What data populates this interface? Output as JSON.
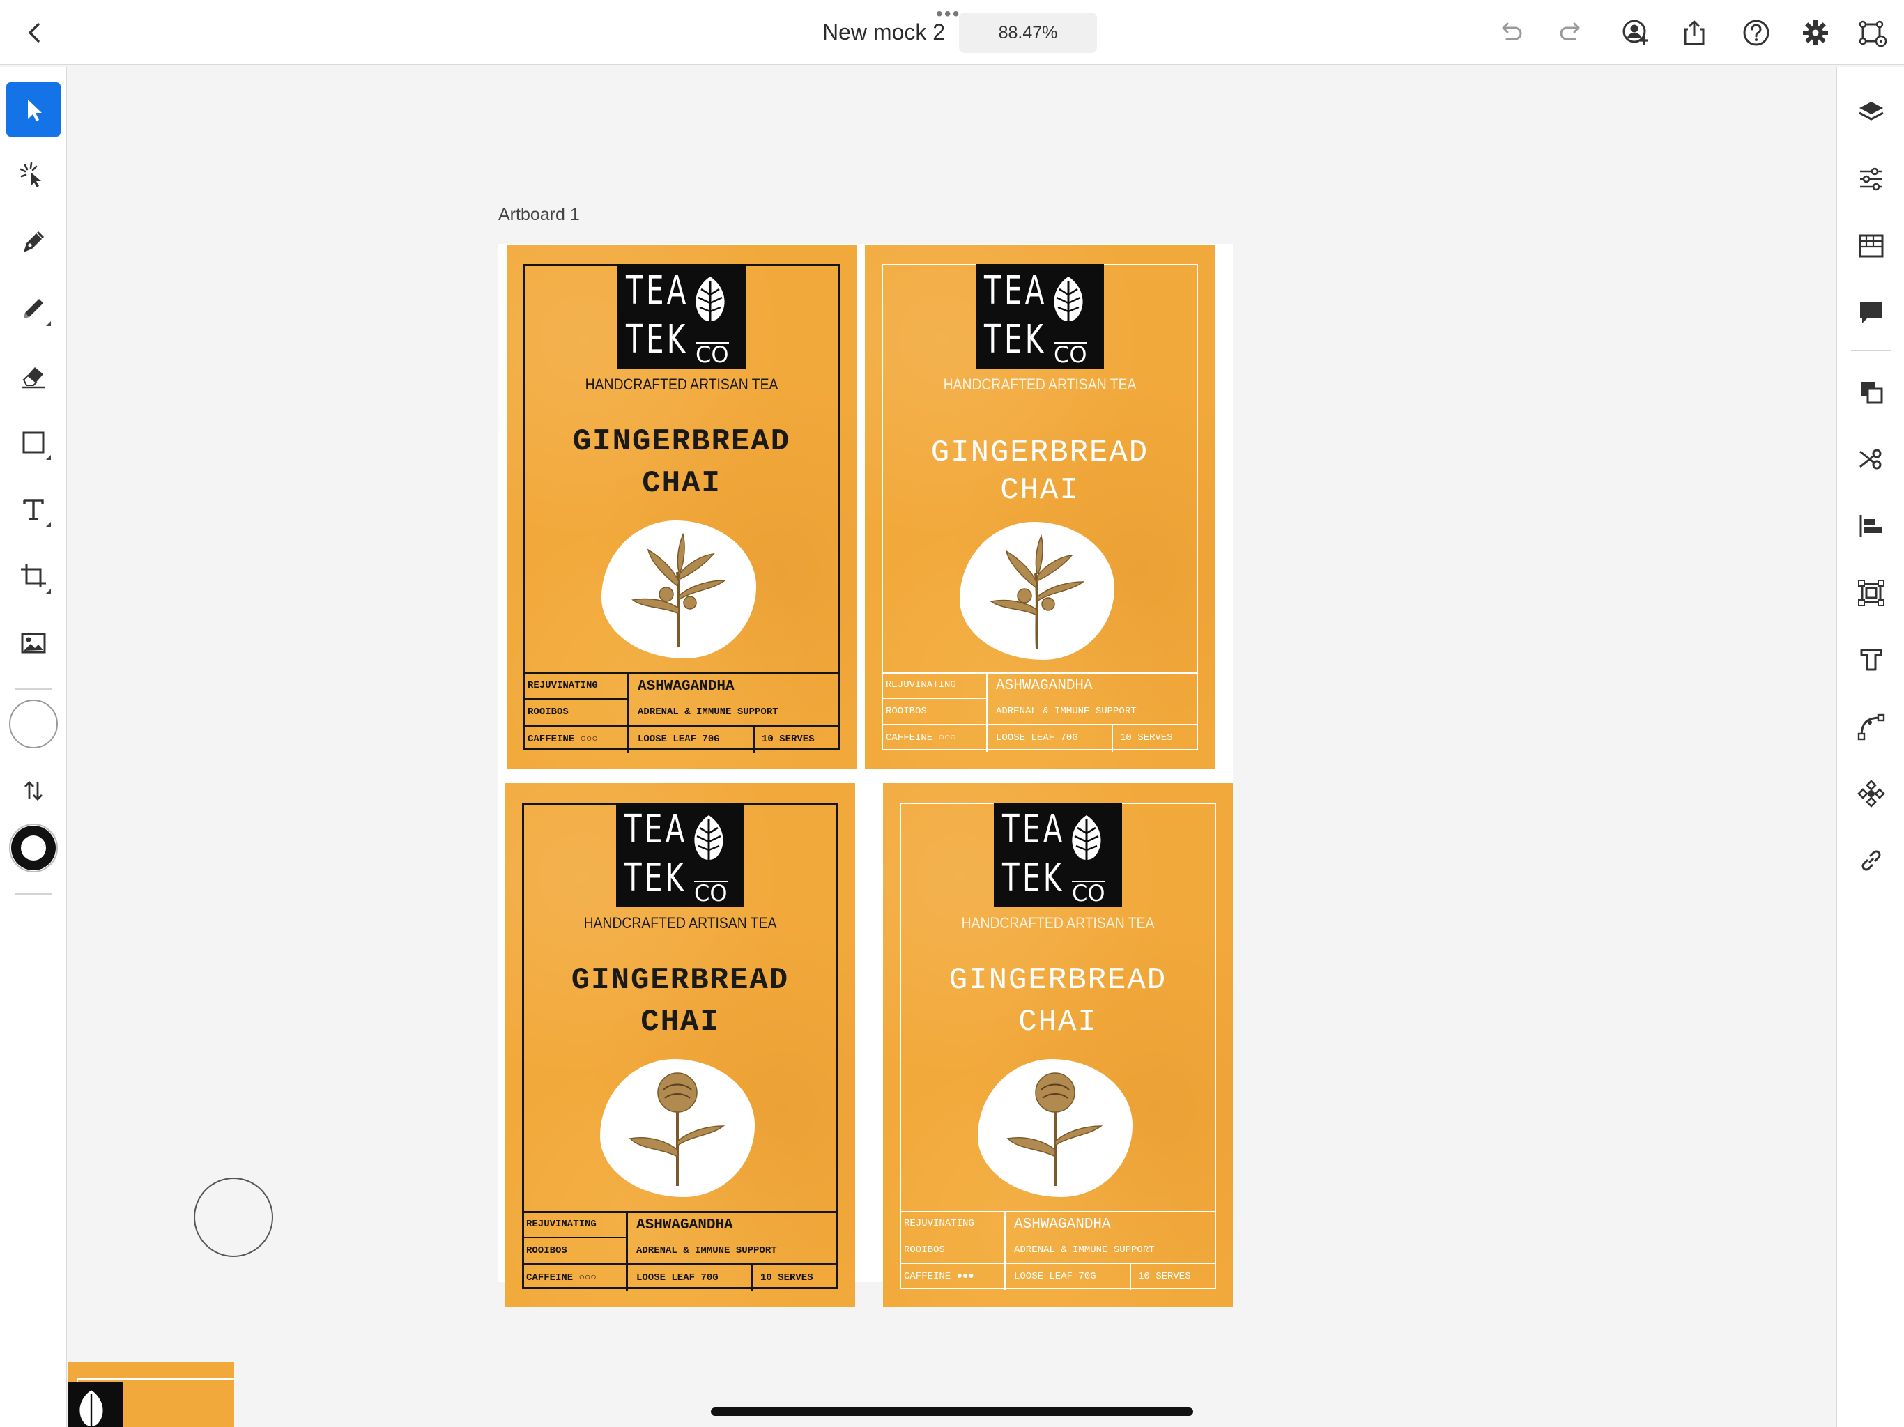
{
  "header": {
    "back_icon": "chevron-left-icon",
    "dots": "•••",
    "title": "New mock 2",
    "zoom": "88.47%",
    "actions": [
      "undo-icon",
      "redo-icon",
      "invite-user-icon",
      "share-icon",
      "help-icon",
      "settings-icon",
      "artboard-settings-icon"
    ]
  },
  "left_tools": [
    "select",
    "repeat-grid",
    "pen",
    "pencil",
    "eraser",
    "rectangle",
    "text",
    "crop",
    "image",
    "fill",
    "swap",
    "stroke"
  ],
  "right_tools": [
    "layers",
    "properties",
    "libraries",
    "comments",
    "arrange",
    "cut",
    "align",
    "repeat",
    "type",
    "path",
    "components",
    "links"
  ],
  "canvas": {
    "artboard_label": "Artboard 1"
  },
  "label": {
    "logo_line1": "TEA",
    "logo_line2": "TEK",
    "logo_small": "CO",
    "tagline": "HANDCRAFTED ARTISAN TEA",
    "name_line1": "GINGERBREAD",
    "name_line2": "CHAI",
    "tbl_rejuvinating": "REJUVINATING",
    "tbl_rooibos": "ROOIBOS",
    "tbl_caffeine": "CAFFEINE ○○○",
    "tbl_caffeine_filled": "CAFFEINE ●●●",
    "tbl_herb": "ASHWAGANDHA",
    "tbl_benefit": "ADRENAL & IMMUNE SUPPORT",
    "tbl_weight": "LOOSE LEAF 70G",
    "tbl_serves": "10 SERVES"
  },
  "colors": {
    "accent": "#1473e6",
    "label_orange": "#f2a93b"
  }
}
